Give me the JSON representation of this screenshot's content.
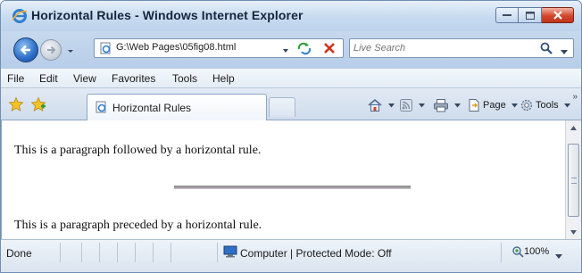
{
  "window": {
    "title": "Horizontal Rules - Windows Internet Explorer"
  },
  "address_bar": {
    "url": "G:\\Web Pages\\05fig08.html"
  },
  "search": {
    "placeholder": "Live Search"
  },
  "menu": {
    "items": [
      "File",
      "Edit",
      "View",
      "Favorites",
      "Tools",
      "Help"
    ]
  },
  "tab": {
    "label": "Horizontal Rules"
  },
  "command_bar": {
    "page_label": "Page",
    "tools_label": "Tools"
  },
  "page": {
    "paragraph_1": "This is a paragraph followed by a horizontal rule.",
    "paragraph_2": "This is a paragraph preceded by a horizontal rule."
  },
  "status": {
    "text": "Done",
    "zone": "Computer | Protected Mode: Off",
    "zoom": "100%"
  },
  "colors": {
    "rule": "#a29fa3",
    "title_bar": "#c7daef",
    "close_button": "#d2462c"
  },
  "icons": [
    "ie-icon",
    "back-icon",
    "forward-icon",
    "page-icon",
    "refresh-icon",
    "stop-icon",
    "search-icon",
    "favorites-star-icon",
    "add-favorites-icon",
    "home-icon",
    "feeds-icon",
    "print-icon",
    "page-menu-icon",
    "tools-gear-icon",
    "computer-zone-icon",
    "zoom-icon"
  ]
}
